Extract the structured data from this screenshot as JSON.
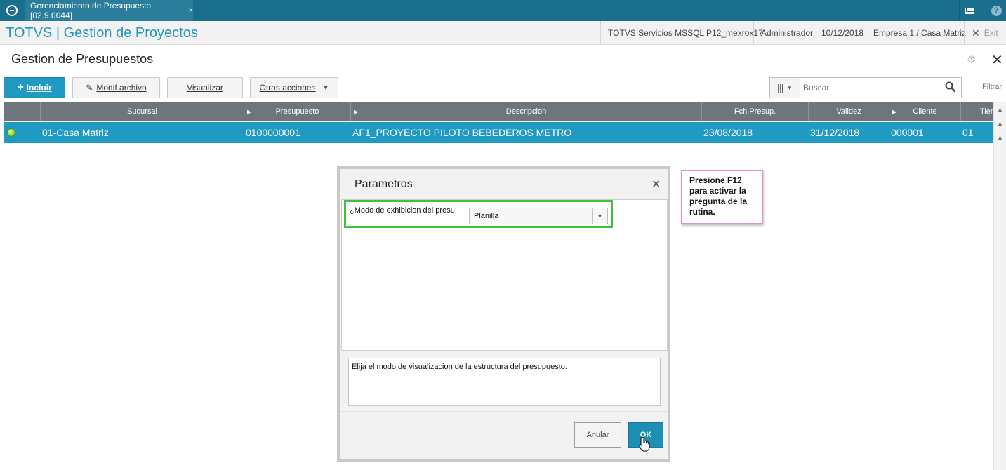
{
  "topbar": {
    "tab_title": "Gerenciamiento de Presupuesto [02.9.0044]",
    "tab_close": "×",
    "help_label": "?"
  },
  "header": {
    "app_title": "TOTVS | Gestion de Proyectos",
    "environment": "TOTVS Servicios MSSQL P12_mexrox17",
    "user": "Administrador",
    "date": "10/12/2018",
    "company": "Empresa 1 / Casa Matriz",
    "exit_label": "Exit"
  },
  "page": {
    "title": "Gestion de Presupuestos"
  },
  "toolbar": {
    "include_label": "Incluir",
    "modify_label": "Modif.archivo",
    "view_label": "Visualizar",
    "other_label": "Otras acciones",
    "search_placeholder": "Buscar",
    "filter_label": "Filtrar"
  },
  "grid": {
    "columns": [
      "Sucursal",
      "Presupuesto",
      "Descripcion",
      "Fch.Presup.",
      "Validez",
      "Cliente",
      "Tien"
    ],
    "rows": [
      {
        "sucursal": "01-Casa Matriz",
        "presupuesto": "0100000001",
        "descripcion": "AF1_PROYECTO PILOTO BEBEDEROS METRO",
        "fecha": "23/08/2018",
        "validez": "31/12/2018",
        "cliente": "000001",
        "tienda": "01"
      }
    ]
  },
  "dialog": {
    "title": "Parametros",
    "question": "¿Modo de exhibicion del presu",
    "selected_value": "Planilla",
    "help_text": "Elija el modo de visualizacion de la estructura del presupuesto.",
    "cancel_label": "Anular",
    "ok_label": "OK"
  },
  "callout": {
    "text": "Presione F12 para activar la pregunta de la rutina."
  },
  "colors": {
    "topbar": "#1b6f8e",
    "accent": "#1e9ac3",
    "grid_header": "#6e767c",
    "highlight": "#3ec23e",
    "callout_border": "#e28fcd"
  }
}
